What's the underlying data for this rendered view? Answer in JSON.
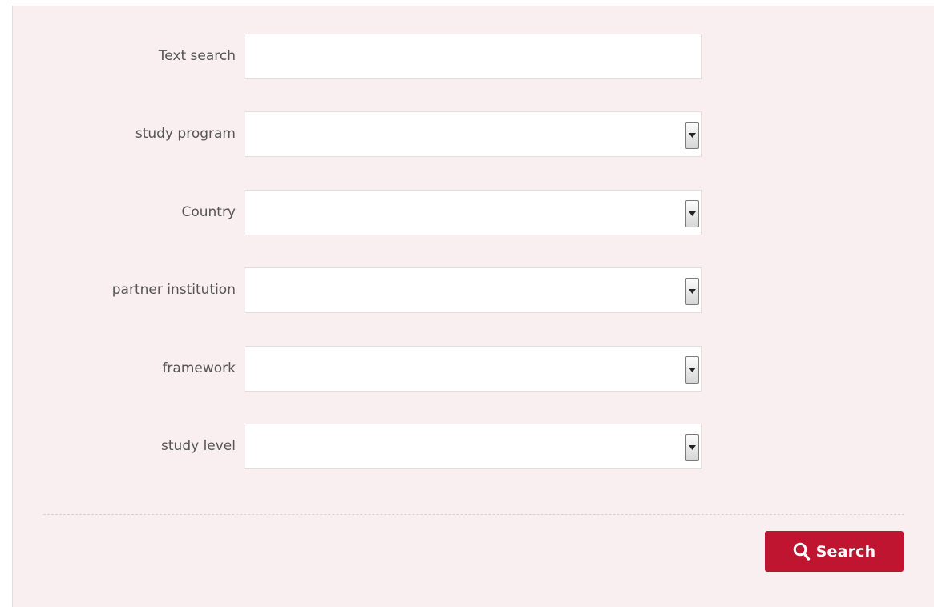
{
  "form": {
    "fields": [
      {
        "label": "Text search",
        "type": "text",
        "value": ""
      },
      {
        "label": "study program",
        "type": "select",
        "value": ""
      },
      {
        "label": "Country",
        "type": "select",
        "value": ""
      },
      {
        "label": "partner institution",
        "type": "select",
        "value": ""
      },
      {
        "label": "framework",
        "type": "select",
        "value": ""
      },
      {
        "label": "study level",
        "type": "select",
        "value": ""
      }
    ],
    "search_button": {
      "label": "Search",
      "icon": "search-icon"
    }
  },
  "colors": {
    "panel_background": "#f9eef0",
    "button_background": "#bf1530",
    "button_text": "#ffffff",
    "label_text": "#555555"
  }
}
